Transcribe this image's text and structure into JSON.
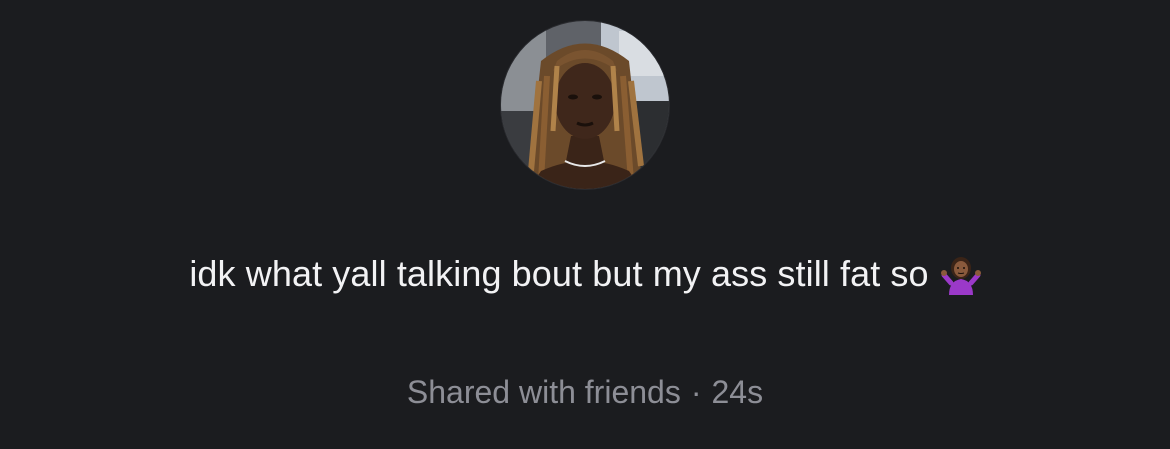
{
  "profile": {
    "avatar_icon": "profile-photo"
  },
  "post": {
    "status_text": "idk what yall talking bout but my ass still fat so",
    "emoji_icon": "person-shrugging-emoji"
  },
  "meta": {
    "audience": "Shared with friends",
    "separator": "·",
    "time_ago": "24s"
  },
  "colors": {
    "background": "#1b1c1f",
    "primary_text": "#f2f2f4",
    "secondary_text": "#8d8e96"
  }
}
